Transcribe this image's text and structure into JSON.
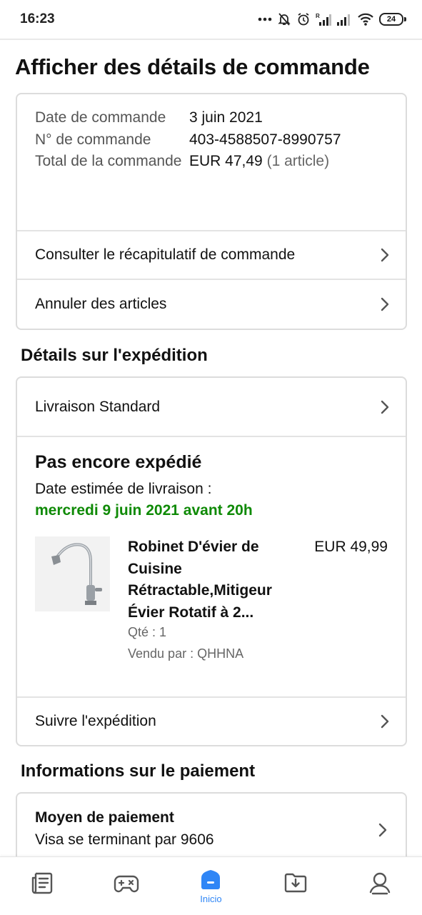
{
  "status_bar": {
    "time": "16:23",
    "battery": "24"
  },
  "page_title": "Afficher des détails de commande",
  "order_summary": {
    "date_label": "Date de commande",
    "date_value": "3 juin 2021",
    "number_label": "N° de commande",
    "number_value": "403-4588507-8990757",
    "total_label": "Total de la commande",
    "total_value": "EUR 47,49",
    "total_items": "(1 article)",
    "summary_link": "Consulter le récapitulatif de commande",
    "cancel_link": "Annuler des articles"
  },
  "shipping": {
    "section_title": "Détails sur l'expédition",
    "method": "Livraison Standard",
    "status": "Pas encore expédié",
    "estimate_label": "Date estimée de livraison :",
    "estimate_date": "mercredi 9 juin 2021 avant 20h",
    "product": {
      "name": "Robinet D'évier de Cuisine Rétractable,Mitigeur Évier Rotatif à 2...",
      "price": "EUR 49,99",
      "qty": "Qté : 1",
      "seller": "Vendu par : QHHNA"
    },
    "track_link": "Suivre l'expédition"
  },
  "payment": {
    "section_title": "Informations sur le paiement",
    "method_title": "Moyen de paiement",
    "method_value": "Visa se terminant par 9606"
  },
  "bottom_nav": {
    "items": [
      {
        "icon": "news-icon"
      },
      {
        "icon": "gamepad-icon"
      },
      {
        "icon": "home-icon",
        "label": "Inicio",
        "active": true
      },
      {
        "icon": "download-folder-icon"
      },
      {
        "icon": "profile-icon"
      }
    ]
  },
  "colors": {
    "accent": "#2f86f6",
    "delivery_green": "#0f8a06",
    "border": "#dcdcdc"
  }
}
